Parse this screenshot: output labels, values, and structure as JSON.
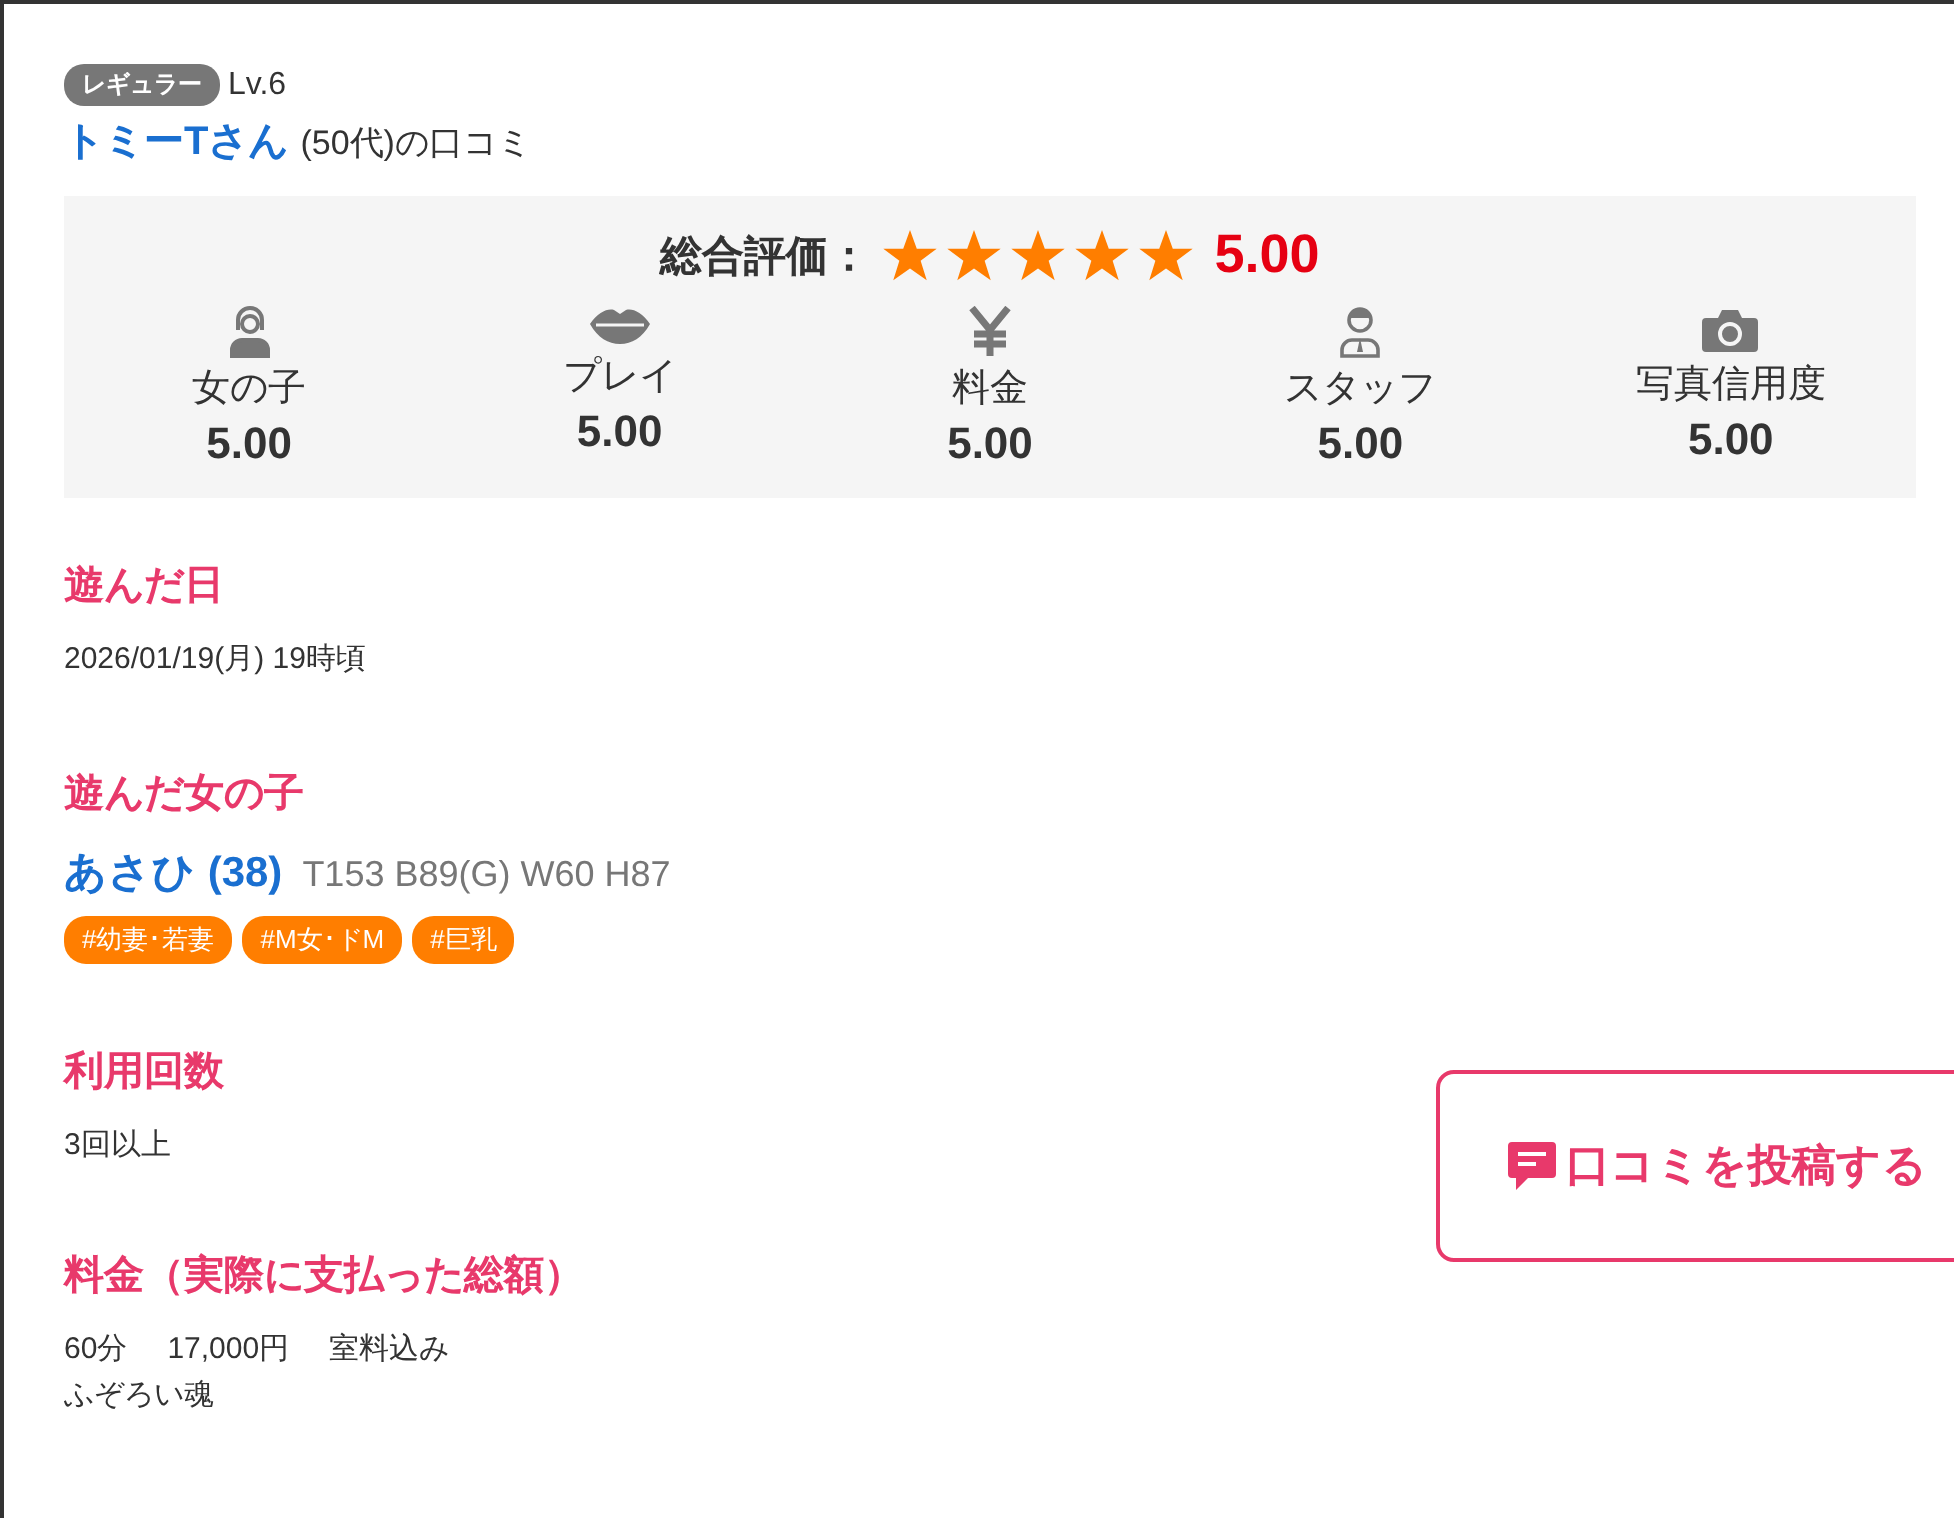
{
  "reviewer": {
    "rank": "レギュラー",
    "level": "Lv.6",
    "name": "トミーTさん",
    "age": "(50代)の口コミ"
  },
  "overall": {
    "label": "総合評価：",
    "stars": 5,
    "score": "5.00"
  },
  "categories": [
    {
      "kind": "girl",
      "label": "女の子",
      "score": "5.00"
    },
    {
      "kind": "lips",
      "label": "プレイ",
      "score": "5.00"
    },
    {
      "kind": "yen",
      "label": "料金",
      "score": "5.00"
    },
    {
      "kind": "staff",
      "label": "スタッフ",
      "score": "5.00"
    },
    {
      "kind": "camera",
      "label": "写真信用度",
      "score": "5.00"
    }
  ],
  "visit_date": {
    "heading": "遊んだ日",
    "value": "2026/01/19(月) 19時頃"
  },
  "girl": {
    "heading": "遊んだ女の子",
    "name": "あさひ (38)",
    "measurements": "T153 B89(G) W60 H87",
    "tags": [
      "#幼妻･若妻",
      "#M女･ドM",
      "#巨乳"
    ]
  },
  "visits": {
    "heading": "利用回数",
    "value": "3回以上"
  },
  "price": {
    "heading": "料金（実際に支払った総額）",
    "items": [
      "60分",
      "17,000円",
      "室料込み"
    ],
    "note": "ふぞろい魂"
  },
  "post_button": "口コミを投稿する"
}
